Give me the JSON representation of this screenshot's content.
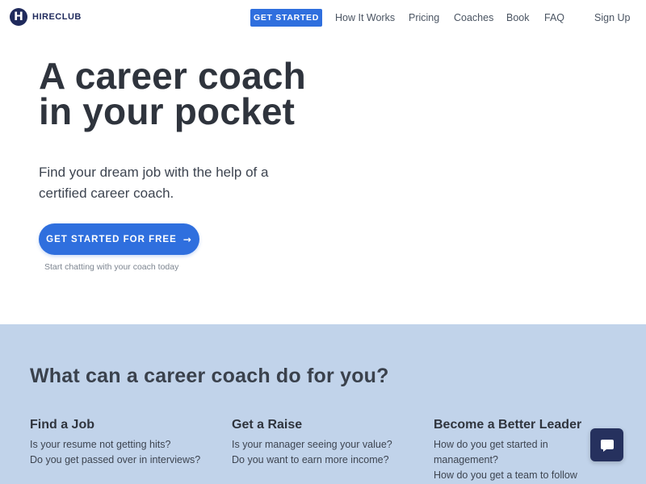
{
  "header": {
    "logo_letter": "H",
    "logo_text": "HIRECLUB",
    "cta": "GET STARTED",
    "nav": [
      "How It Works",
      "Pricing",
      "Coaches",
      "Book",
      "FAQ",
      "Sign Up"
    ]
  },
  "hero": {
    "title_line1": "A career coach",
    "title_line2": "in your pocket",
    "subtitle": "Find your dream job with the help of a certified career coach.",
    "cta": "GET STARTED FOR FREE",
    "note": "Start chatting with your coach today"
  },
  "features": {
    "title": "What can a career coach do for you?",
    "columns": [
      {
        "title": "Find a Job",
        "lines": [
          "Is your resume not getting hits?",
          "Do you get passed over in interviews?"
        ]
      },
      {
        "title": "Get a Raise",
        "lines": [
          "Is your manager seeing your value?",
          "Do you want to earn more income?"
        ]
      },
      {
        "title": "Become a Better Leader",
        "lines": [
          "How do you get started in management?",
          "How do you get a team to follow you?"
        ]
      }
    ]
  },
  "colors": {
    "brand_navy": "#1f2a5c",
    "accent_blue": "#2f6fde",
    "features_bg": "#c1d3ea",
    "chat_button": "#26315e"
  },
  "icons": {
    "logo": "hireclub-logo-icon",
    "chat": "chat-bubble-icon",
    "arrow": "arrow-right-icon"
  }
}
